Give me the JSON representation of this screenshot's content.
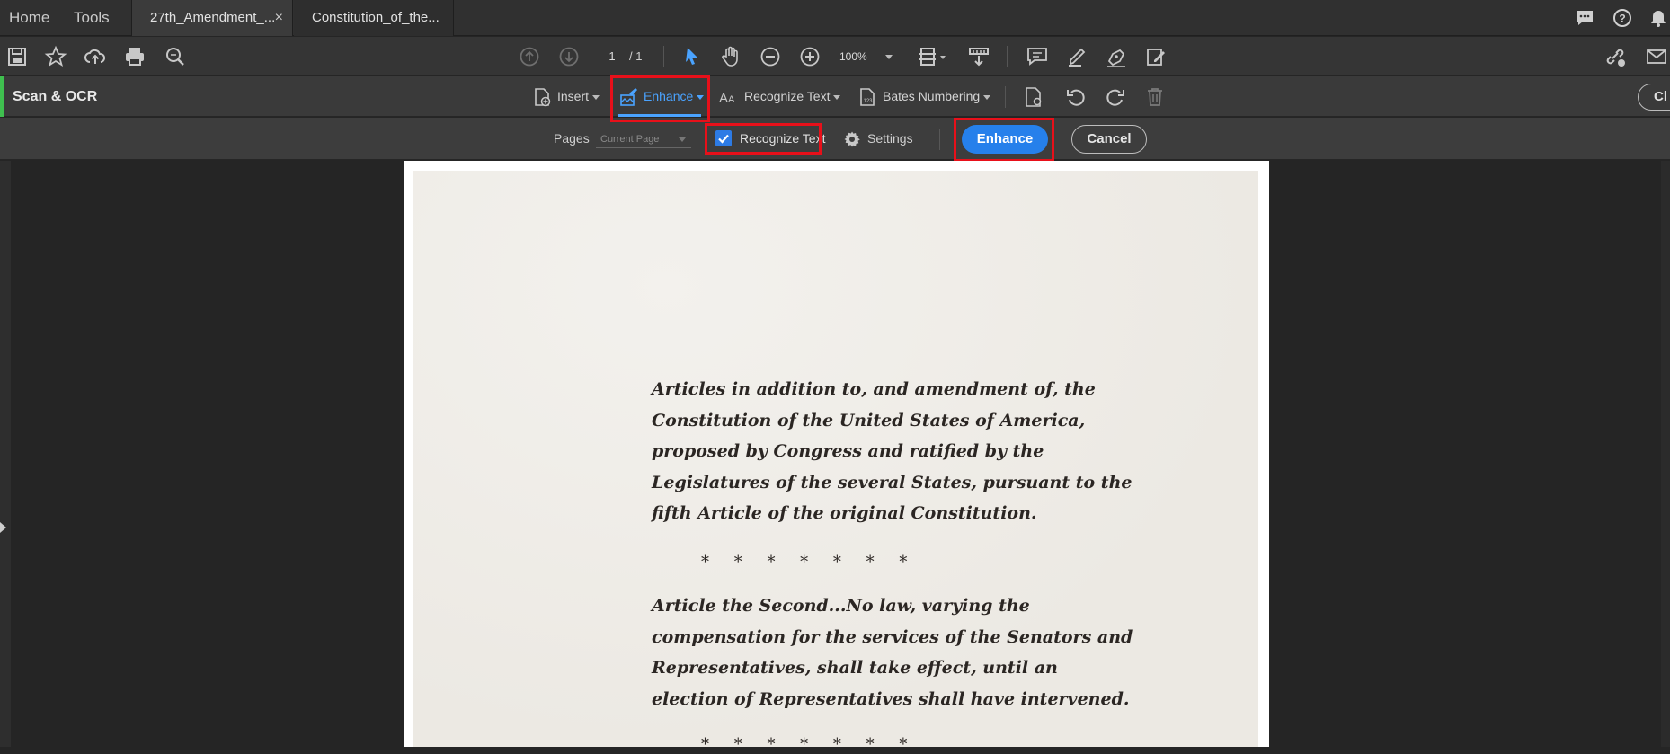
{
  "topbar": {
    "home": "Home",
    "tools": "Tools",
    "tabs": [
      {
        "label": "27th_Amendment_...",
        "close": "×"
      },
      {
        "label": "Constitution_of_the..."
      }
    ]
  },
  "toolbar": {
    "page_current": "1",
    "page_total": "/ 1",
    "zoom": "100%"
  },
  "scan_ocr": {
    "title": "Scan & OCR",
    "insert": "Insert",
    "enhance": "Enhance",
    "recognize_text": "Recognize Text",
    "bates_numbering": "Bates Numbering",
    "close": "Cl"
  },
  "options": {
    "pages_label": "Pages",
    "pages_value": "Current Page",
    "recognize_text_checkbox": "Recognize Text",
    "settings": "Settings",
    "enhance_button": "Enhance",
    "cancel_button": "Cancel"
  },
  "document": {
    "paragraph1": [
      "Articles in addition to, and amendment of, the",
      "Constitution of the United States of America,",
      "proposed by Congress and ratified by the",
      "Legislatures of the several States, pursuant to the",
      "fifth Article of the original Constitution."
    ],
    "separator": "* * * * * * *",
    "paragraph2": [
      "Article the Second...No law, varying the",
      "compensation for the services of the Senators and",
      "Representatives, shall take effect, until an",
      "election of Representatives shall have intervened."
    ]
  },
  "colors": {
    "accent_blue": "#2680eb",
    "highlight_red": "#e8101a",
    "tool_accent_green": "#3fbf4f"
  }
}
